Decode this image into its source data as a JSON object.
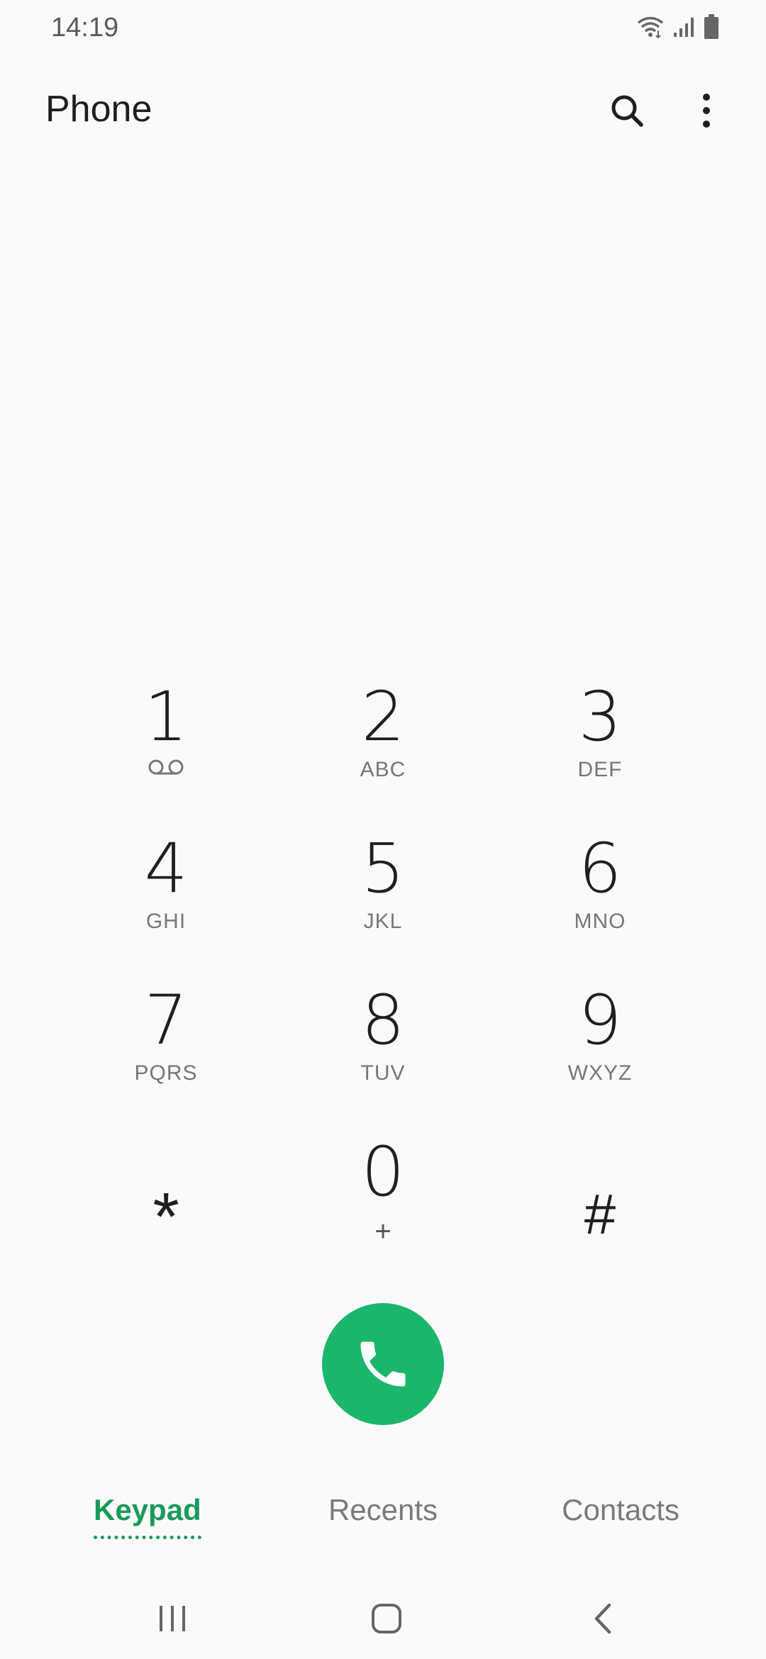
{
  "status_bar": {
    "time": "14:19",
    "icons": [
      "wifi-icon",
      "signal-icon",
      "battery-icon"
    ]
  },
  "app_bar": {
    "title": "Phone",
    "actions": [
      "search-icon",
      "more-options-icon"
    ]
  },
  "keypad": {
    "rows": [
      [
        {
          "digit": "1",
          "letters": "",
          "sub_icon": "voicemail-icon"
        },
        {
          "digit": "2",
          "letters": "ABC"
        },
        {
          "digit": "3",
          "letters": "DEF"
        }
      ],
      [
        {
          "digit": "4",
          "letters": "GHI"
        },
        {
          "digit": "5",
          "letters": "JKL"
        },
        {
          "digit": "6",
          "letters": "MNO"
        }
      ],
      [
        {
          "digit": "7",
          "letters": "PQRS"
        },
        {
          "digit": "8",
          "letters": "TUV"
        },
        {
          "digit": "9",
          "letters": "WXYZ"
        }
      ],
      [
        {
          "digit": "*",
          "letters": ""
        },
        {
          "digit": "0",
          "letters": "+"
        },
        {
          "digit": "#",
          "letters": ""
        }
      ]
    ]
  },
  "call_button": {
    "icon": "phone-icon",
    "color": "#1ab66d"
  },
  "tabs": {
    "items": [
      {
        "label": "Keypad",
        "active": true
      },
      {
        "label": "Recents",
        "active": false
      },
      {
        "label": "Contacts",
        "active": false
      }
    ],
    "accent_color": "#1a9a5a"
  },
  "nav_bar": {
    "buttons": [
      "recent-apps-icon",
      "home-icon",
      "back-icon"
    ]
  }
}
